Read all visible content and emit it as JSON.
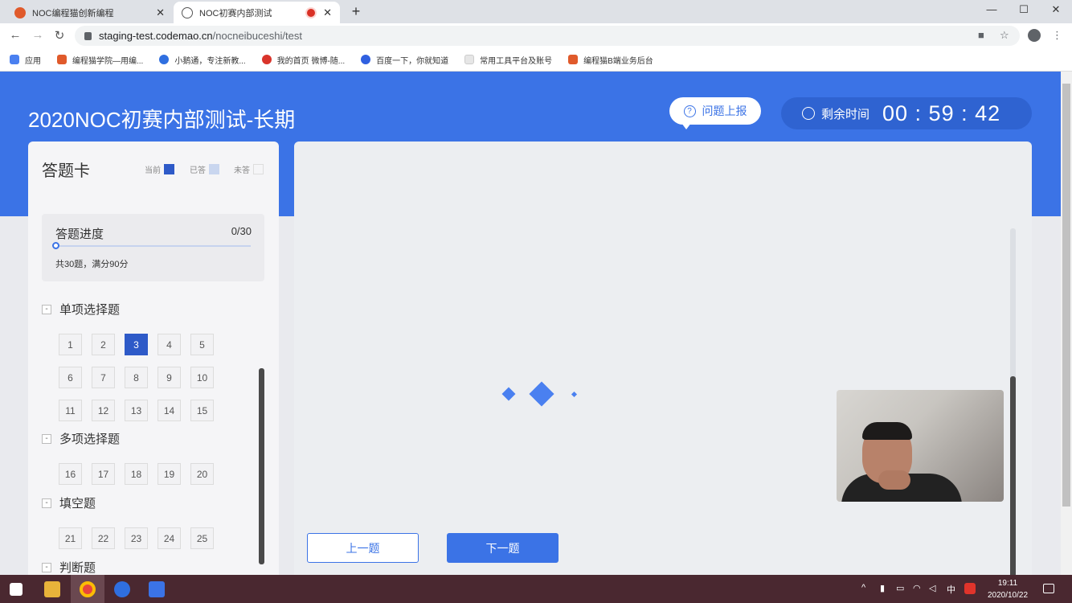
{
  "browser": {
    "tabs": [
      {
        "title": "NOC编程猫创新编程",
        "close": "✕"
      },
      {
        "title": "NOC初赛内部测试",
        "close": "✕"
      }
    ],
    "new_tab": "+",
    "window_controls": [
      "—",
      "☐",
      "✕"
    ],
    "url_host": "staging-test.codemao.cn",
    "url_path": "/nocneibuceshi/test",
    "bookmarks": [
      {
        "label": "应用",
        "icon": "apps-grid-icon",
        "color": "#4a80f0"
      },
      {
        "label": "编程猫学院—用编...",
        "icon": "codemao-icon",
        "color": "#e05a2b"
      },
      {
        "label": "小鹅通，专注新教...",
        "icon": "xiaoe-icon",
        "color": "#2f6fe0"
      },
      {
        "label": "我的首页 微博-随...",
        "icon": "weibo-icon",
        "color": "#d9342b"
      },
      {
        "label": "百度一下，你就知道",
        "icon": "baidu-icon",
        "color": "#3060e0"
      },
      {
        "label": "常用工具平台及账号",
        "icon": "folder-icon",
        "color": "#e6e6e6"
      },
      {
        "label": "编程猫B端业务后台",
        "icon": "codemao-icon",
        "color": "#e05a2b"
      }
    ]
  },
  "header": {
    "exam_title": "2020NOC初赛内部测试-长期",
    "report_label": "问题上报",
    "timer_label": "剩余时间",
    "timer_value": "00 : 59 : 42"
  },
  "card": {
    "title": "答题卡",
    "legend": [
      {
        "label": "当前",
        "color": "#2e5ac8"
      },
      {
        "label": "已答",
        "color": "#c9d6ef"
      },
      {
        "label": "未答",
        "color": "#f5f5f7"
      }
    ],
    "progress_label": "答题进度",
    "progress_value": "0/30",
    "progress_fraction": 0,
    "progress_note": "共30题，满分90分",
    "sections": [
      {
        "title": "单项选择题",
        "toggle": "-",
        "questions": [
          "1",
          "2",
          "3",
          "4",
          "5",
          "6",
          "7",
          "8",
          "9",
          "10",
          "11",
          "12",
          "13",
          "14",
          "15"
        ],
        "current": "3"
      },
      {
        "title": "多项选择题",
        "toggle": "-",
        "questions": [
          "16",
          "17",
          "18",
          "19",
          "20"
        ]
      },
      {
        "title": "填空题",
        "toggle": "-",
        "questions": [
          "21",
          "22",
          "23",
          "24",
          "25"
        ]
      },
      {
        "title": "判断题",
        "toggle": "-",
        "questions": []
      }
    ]
  },
  "nav": {
    "prev_label": "上一题",
    "next_label": "下一题"
  },
  "taskbar": {
    "time": "19:11",
    "date": "2020/10/22",
    "ime": "中"
  }
}
